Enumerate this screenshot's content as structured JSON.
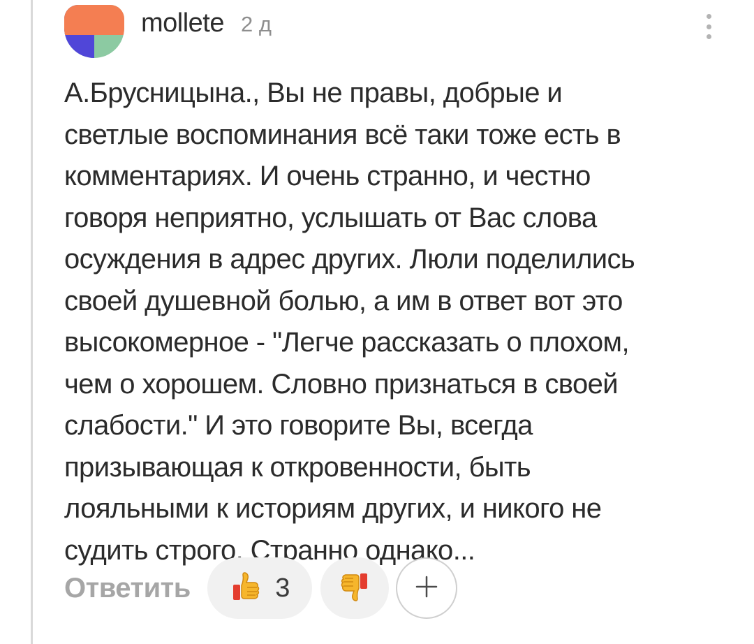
{
  "thread": {
    "line_color": "#d9d9d9"
  },
  "comment": {
    "avatar_icon": "user-avatar-icon",
    "username": "mollete",
    "time_ago": "2 д",
    "menu_icon": "vertical-dots-icon",
    "text": "А.Брусницына., Вы не правы, добрые и\nсветлые воспоминания всё таки тоже есть в\nкомментариях. И очень странно, и честно\nговоря неприятно, услышать от Вас слова\nосуждения в адрес других. Люли поделились\nсвоей душевной болью, а им в ответ вот это\nвысокомерное - \"Легче рассказать о плохом,\nчем о хорошем. Словно признаться в своей\nслабости.\" И это говорите Вы, всегда\nпризывающая к откровенности, быть\nлояльными к историям других, и никого не\nсудить строго. Странно однако..."
  },
  "actions": {
    "reply_label": "Ответить",
    "like": {
      "icon": "thumbs-up-icon",
      "count": "3"
    },
    "dislike": {
      "icon": "thumbs-down-icon"
    },
    "add_reaction_icon": "plus-icon"
  },
  "colors": {
    "avatar_top": "#f47e52",
    "avatar_bottom_left": "#5046d8",
    "avatar_bottom_right": "#8ccaa2",
    "text": "#2b2b2b",
    "muted": "#8e8e8e",
    "pill_background": "#f1f1f1",
    "thumb_yellow": "#f6b62c",
    "thumb_red": "#e43d2f"
  }
}
